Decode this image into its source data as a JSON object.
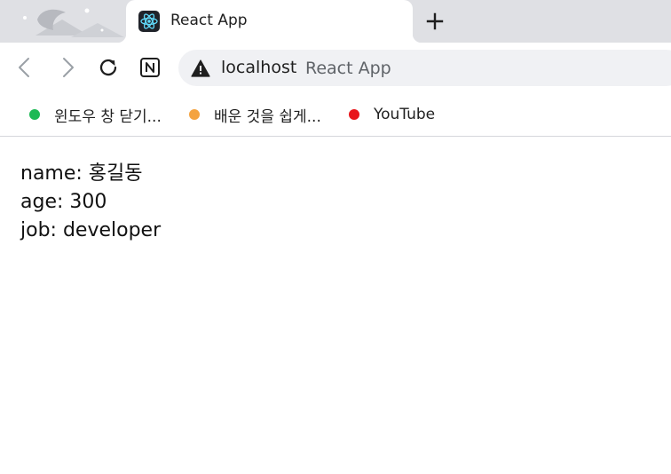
{
  "tab": {
    "title": "React App"
  },
  "address_bar": {
    "host": "localhost",
    "page_title": "React App"
  },
  "bookmarks": [
    {
      "label": "윈도우 창 닫기...",
      "color": "#1db954"
    },
    {
      "label": "배운 것을 쉽게...",
      "color": "#f4a340"
    },
    {
      "label": "YouTube",
      "color": "#e8161b"
    }
  ],
  "content": {
    "lines": [
      "name: 홍길동",
      "age: 300",
      "job: developer"
    ]
  },
  "icons": {
    "favicon": "react-logo-icon",
    "new_tab": "plus-icon",
    "back": "back-arrow-icon",
    "forward": "forward-arrow-icon",
    "reload": "reload-icon",
    "notion": "notion-icon",
    "security": "warning-triangle-icon"
  }
}
